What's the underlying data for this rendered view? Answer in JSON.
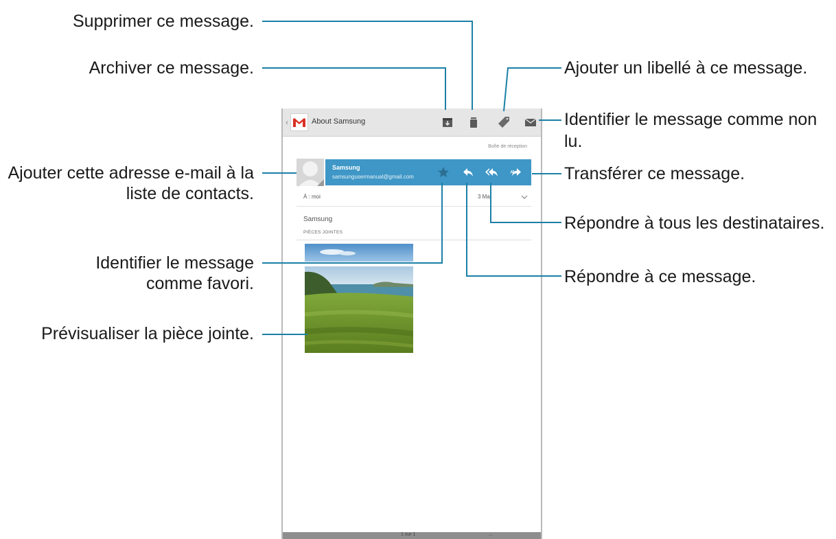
{
  "callouts": {
    "delete": "Supprimer ce message.",
    "archive": "Archiver ce message.",
    "label": "Ajouter un libellé à ce message.",
    "unread_1": "Identifier le message comme non",
    "unread_2": "lu.",
    "add_contact_1": "Ajouter cette adresse e-mail à la",
    "add_contact_2": "liste de contacts.",
    "forward": "Transférer ce message.",
    "reply_all": "Répondre à tous les destinataires.",
    "favorite_1": "Identifier le message",
    "favorite_2": "comme favori.",
    "reply": "Répondre à ce message.",
    "preview": "Prévisualiser la pièce jointe."
  },
  "actionbar": {
    "back": "‹",
    "title": "About Samsung",
    "icons": [
      "archive-icon",
      "trash-icon",
      "label-icon",
      "mark-unread-icon"
    ]
  },
  "message": {
    "folder": "Boîte de réception",
    "sender_name": "Samsung",
    "sender_email": "samsungusermanual@gmail.com",
    "to_label": "À : moi",
    "date": "3 Ma",
    "body": "Samsung",
    "attachments_header": "PIÈCES JOINTES",
    "actions": [
      "star-icon",
      "reply-icon",
      "reply-all-icon",
      "forward-icon"
    ]
  },
  "bottombar": {
    "center": "1 sur 1",
    "right": "..."
  },
  "colors": {
    "accent": "#3e97c6",
    "leader": "#1b7fa6",
    "actionbar": "#e6e6e6",
    "gmail_red": "#d93025"
  }
}
